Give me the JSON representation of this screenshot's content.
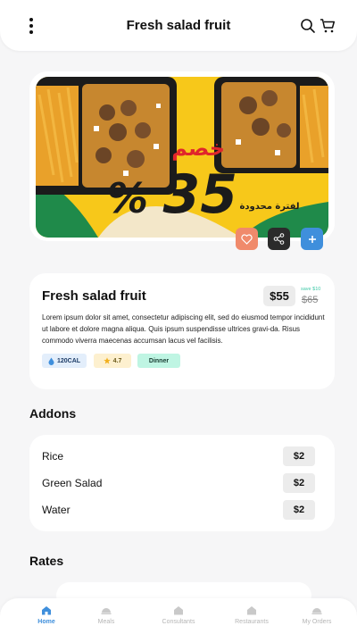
{
  "header": {
    "title": "Fresh salad fruit"
  },
  "banner": {
    "offer_word": "خصم",
    "offer_value": "35",
    "offer_percent": "%",
    "offer_note": "لفترة محدودة"
  },
  "product": {
    "name": "Fresh salad fruit",
    "price": "$55",
    "save_note": "save $10",
    "old_price": "$65",
    "description": "Lorem ipsum dolor sit amet, consectetur adipiscing elit, sed do eiusmod tempor incididunt ut labore et dolore magna aliqua. Quis ipsum suspendisse ultrices gravi-da. Risus commodo viverra maecenas accumsan lacus vel facilisis.",
    "calories": "120CAL",
    "rating": "4.7",
    "meal_type": "Dinner"
  },
  "addons": {
    "title": "Addons",
    "items": [
      {
        "label": "Rice",
        "price": "$2"
      },
      {
        "label": "Green Salad",
        "price": "$2"
      },
      {
        "label": "Water",
        "price": "$2"
      }
    ]
  },
  "rates": {
    "title": "Rates"
  },
  "nav": {
    "items": [
      {
        "label": "Home",
        "icon": "home-icon"
      },
      {
        "label": "Meals",
        "icon": "meal-icon"
      },
      {
        "label": "Consultants",
        "icon": "consultant-icon"
      },
      {
        "label": "Restaurants",
        "icon": "restaurant-icon"
      },
      {
        "label": "My Orders",
        "icon": "orders-icon"
      }
    ]
  },
  "colors": {
    "accent": "#3f8fdc",
    "favorite": "#f08a6b",
    "share": "#2b2b2b",
    "add": "#3f8fdc",
    "banner_yellow": "#f7c81a",
    "banner_green": "#1f8a4a",
    "offer_red": "#e0262b"
  }
}
